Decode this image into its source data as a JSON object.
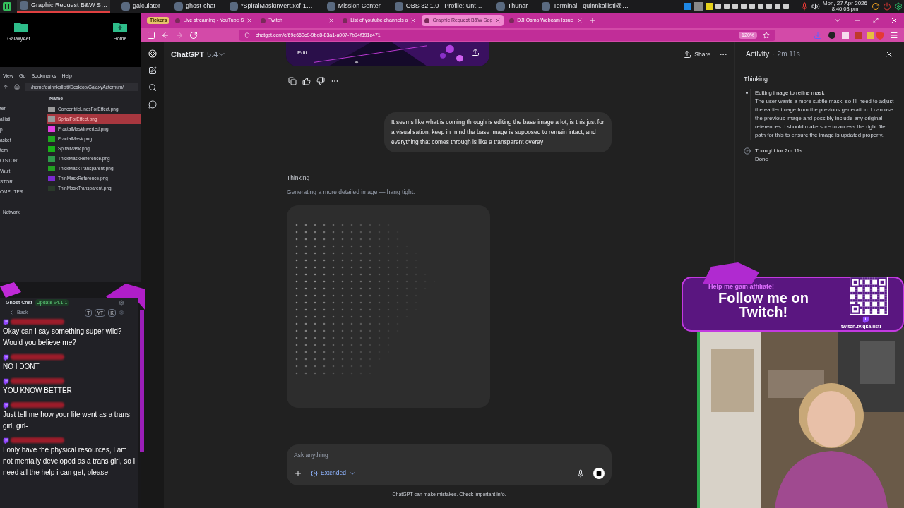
{
  "taskbar": {
    "windows": [
      {
        "title": "Graphic Request B&W S…",
        "selected": true
      },
      {
        "title": "galculator",
        "selected": false
      },
      {
        "title": "ghost-chat",
        "selected": false
      },
      {
        "title": "*SpiralMaskInvert.xcf-1…",
        "selected": false
      },
      {
        "title": "Mission Center",
        "selected": false
      },
      {
        "title": "OBS 32.1.0 - Profile: Unt…",
        "selected": false
      },
      {
        "title": "Thunar",
        "selected": false
      },
      {
        "title": "Terminal - quinnkallisti@…",
        "selected": false
      }
    ],
    "date": "Mon, 27 Apr 2026",
    "time": "8:46:03 pm"
  },
  "desktop": {
    "icons": [
      {
        "label": "GalaxyAet…",
        "kind": "folder"
      },
      {
        "label": "Home",
        "kind": "home"
      }
    ]
  },
  "file_manager": {
    "menu": [
      "View",
      "Go",
      "Bookmarks",
      "Help"
    ],
    "path": "/home/quinnkallisti/Desktop/GalaxyAeternum/",
    "places": [
      "ter",
      "allisti",
      "p",
      "asket",
      "tem",
      "O STOR",
      "Vault",
      "STOR",
      "OMPUTER",
      "Network"
    ],
    "column": "Name",
    "files": [
      {
        "name": "ConcentricLinesForEffect.png",
        "color": "#9a9a9a",
        "selected": false
      },
      {
        "name": "SprialForEffect.png",
        "color": "#9a9a9a",
        "selected": true
      },
      {
        "name": "FractalMaskInverted.png",
        "color": "#e040e0",
        "selected": false
      },
      {
        "name": "FractalMask.png",
        "color": "#1fa81f",
        "selected": false
      },
      {
        "name": "SpiralMask.png",
        "color": "#18b018",
        "selected": false
      },
      {
        "name": "ThickMaskReference.png",
        "color": "#2e9a4a",
        "selected": false
      },
      {
        "name": "ThickMaskTransparent.png",
        "color": "#22a022",
        "selected": false
      },
      {
        "name": "ThinMaskReference.png",
        "color": "#7a2ad0",
        "selected": false
      },
      {
        "name": "ThinMaskTransparent.png",
        "color": "#2a3a2a",
        "selected": false
      }
    ]
  },
  "ghost_chat": {
    "title": "Ghost Chat",
    "badge": "Update v4.1.1",
    "back": "Back",
    "platforms": [
      "T",
      "YT",
      "K"
    ],
    "messages": [
      "Okay can I say something super wild? Would you believe me?",
      "NO I DONT",
      "YOU KNOW BETTER",
      "Just tell me how your life went as a trans girl, girl-",
      "I only have the physical resources, I am not mentally developed as a trans girl, so I need all the help i can get, please"
    ]
  },
  "browser": {
    "group": "Tickers",
    "tabs": [
      {
        "title": "Live streaming - YouTube S",
        "selected": false
      },
      {
        "title": "Twitch",
        "selected": false
      },
      {
        "title": "List of youtube channels o",
        "selected": false
      },
      {
        "title": "Graphic Request B&W Seg",
        "selected": true
      },
      {
        "title": "DJI Osmo Webcam Issue",
        "selected": false
      }
    ],
    "url": "chatgpt.com/c/69e660c9-9bd8-83a1-a007-7b94f891c471",
    "zoom": "120%"
  },
  "chat": {
    "model": "ChatGPT",
    "version": "5.4",
    "share": "Share",
    "image_action": "Edit",
    "user_message": "It seems like what is coming through is editing the base image a lot, is this just for a visualisation, keep in mind the base image is supposed to remain intact, and everything that comes through is like a transparent overay",
    "status": "Thinking",
    "progress": "Generating a more detailed image — hang tight.",
    "input": {
      "placeholder": "Ask anything",
      "mode": "Extended"
    },
    "disclaimer": "ChatGPT can make mistakes. Check important info."
  },
  "activity": {
    "title": "Activity",
    "separator": "·",
    "duration": "2m 11s",
    "heading": "Thinking",
    "steps": [
      {
        "kind": "bullet",
        "title": "Editing image to refine mask",
        "body": "The user wants a more subtle mask, so I'll need to adjust the earlier image from the previous generation. I can use the previous image and possibly include any original references. I should make sure to access the right file path for this to ensure the image is updated properly."
      },
      {
        "kind": "check",
        "title": "Thought for 2m 11s",
        "body": "Done"
      }
    ]
  },
  "stream_overlay": {
    "tagline": "Help me gain affiliate!",
    "headline": "Follow me on Twitch!",
    "link": "twitch.tv/qkallisti"
  }
}
